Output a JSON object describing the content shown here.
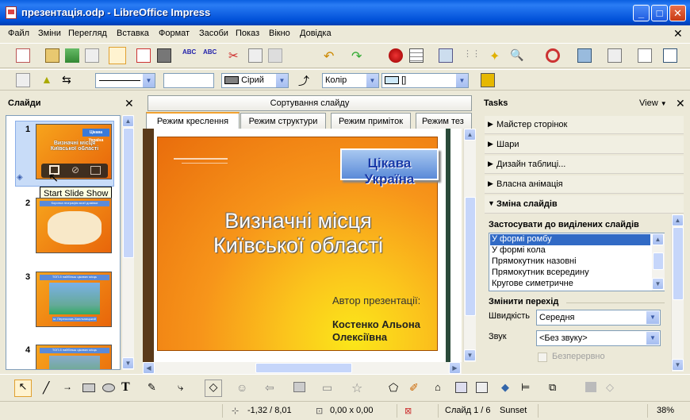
{
  "window": {
    "title": "презентація.odp - LibreOffice Impress",
    "min": "_",
    "max": "□",
    "close": "✕"
  },
  "menu": [
    "Файл",
    "Зміни",
    "Перегляд",
    "Вставка",
    "Формат",
    "Засоби",
    "Показ",
    "Вікно",
    "Довідка"
  ],
  "toolbar2": {
    "line_style": "",
    "width_value": "",
    "area_color": "Сірий",
    "area_type": "Колір",
    "area_fill": "[]"
  },
  "slides_panel": {
    "title": "Слайди",
    "close": "✕",
    "tooltip": "Start Slide Show",
    "thumbs": [
      {
        "num": "1",
        "badge": "Цікава Україна",
        "title": "Визначні місця Київської області"
      },
      {
        "num": "2",
        "title": "Коротка географія моєї домівки"
      },
      {
        "num": "3",
        "title": "ТОП-5 найбільш цікавих місць",
        "caption": "м. Переяслав-Хмельницький"
      },
      {
        "num": "4",
        "title": "ТОП-5 найбільш цікавих місць"
      }
    ]
  },
  "tabs": {
    "top": "Сортування слайду",
    "views": [
      "Режим креслення",
      "Режим структури",
      "Режим приміток",
      "Режим тез"
    ]
  },
  "slide": {
    "badge": "Цікава Україна",
    "title_line1": "Визначні місця",
    "title_line2": "Київської області",
    "author_label": "Автор презентації:",
    "author_name1": "Костенко Альона",
    "author_name2": "Олексіївна"
  },
  "tasks": {
    "title": "Tasks",
    "view": "View",
    "close": "✕",
    "sections": [
      "Майстер сторінок",
      "Шари",
      "Дизайн таблиці...",
      "Власна анімація",
      "Зміна слайдів"
    ],
    "apply_label": "Застосувати до виділених слайдів",
    "transitions": [
      "У формі ромбу",
      "У формі кола",
      "Прямокутник назовні",
      "Прямокутник всередину",
      "Кругове симетричне"
    ],
    "modify_label": "Змінити перехід",
    "speed_label": "Швидкість",
    "speed_value": "Середня",
    "sound_label": "Звук",
    "sound_value": "<Без звуку>",
    "loop_label": "Безперервно"
  },
  "status": {
    "position": "-1,32 / 8,01",
    "size": "0,00 x 0,00",
    "slide": "Слайд 1 / 6",
    "theme": "Sunset",
    "zoom": "38%"
  }
}
